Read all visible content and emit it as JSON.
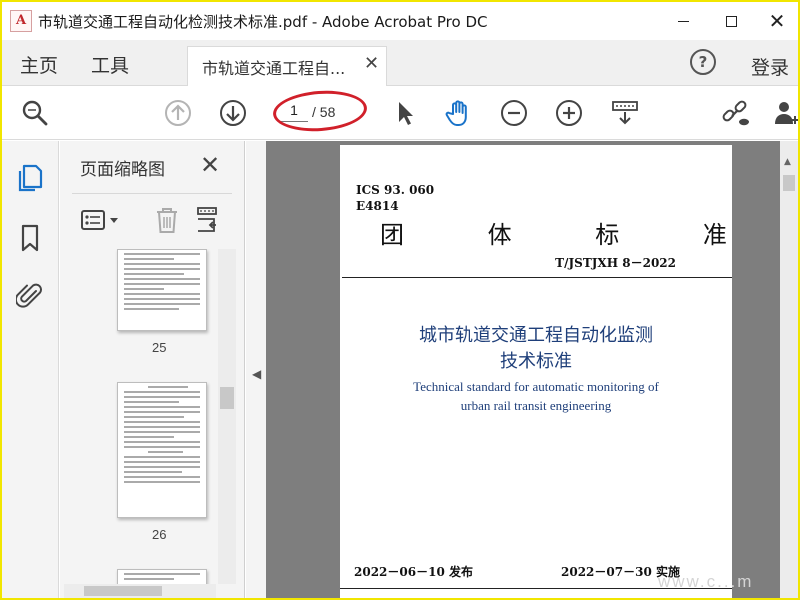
{
  "window": {
    "title": "市轨道交通工程自动化检测技术标准.pdf - Adobe Acrobat Pro DC",
    "app_icon": "acrobat-pdf-icon"
  },
  "menubar": {
    "home_label": "主页",
    "tools_label": "工具",
    "doc_tab_label": "市轨道交通工程自...",
    "login_label": "登录"
  },
  "toolbar": {
    "current_page": "1",
    "total_pages": "/ 58",
    "icons": [
      "zoom-search-icon",
      "prev-page-icon",
      "next-page-icon",
      "select-cursor-icon",
      "hand-tool-icon",
      "zoom-out-icon",
      "zoom-in-icon",
      "page-display-icon",
      "share-link-icon",
      "add-user-icon"
    ]
  },
  "panel": {
    "title": "页面缩略图",
    "thumbnails": [
      {
        "label": "25"
      },
      {
        "label": "26"
      }
    ]
  },
  "document": {
    "ics": "ICS 93. 060",
    "e_code": "E4814",
    "standard_type": "团 体 标 准",
    "standard_code": "T/JSTJXH 8－2022",
    "title_cn_line1": "城市轨道交通工程自动化监测",
    "title_cn_line2": "技术标准",
    "title_en_line1": "Technical standard for automatic monitoring of",
    "title_en_line2": "urban rail transit engineering",
    "issue_date": "2022－06－10  发布",
    "effective_date": "2022－07－30  实施"
  },
  "watermark": "www.c...m"
}
